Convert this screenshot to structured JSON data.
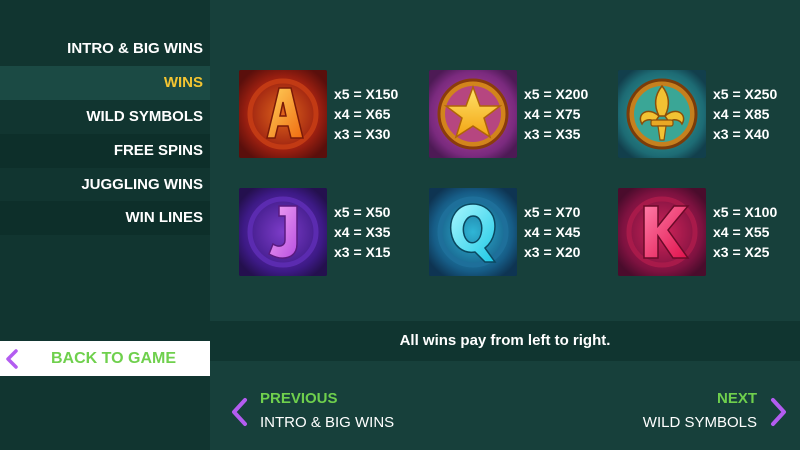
{
  "sidebar": {
    "items": [
      {
        "label": "INTRO & BIG WINS"
      },
      {
        "label": "WINS",
        "active": true
      },
      {
        "label": "WILD SYMBOLS"
      },
      {
        "label": "FREE SPINS"
      },
      {
        "label": "JUGGLING WINS"
      },
      {
        "label": "WIN LINES"
      }
    ],
    "back_label": "BACK TO GAME"
  },
  "symbols": [
    {
      "icon": "letter-a-symbol",
      "payouts": [
        "x5 = X150",
        "x4 = X65",
        "x3 = X30"
      ]
    },
    {
      "icon": "star-symbol",
      "payouts": [
        "x5 = X200",
        "x4 = X75",
        "x3 = X35"
      ]
    },
    {
      "icon": "fleur-de-lis-symbol",
      "payouts": [
        "x5 = X250",
        "x4 = X85",
        "x3 = X40"
      ]
    },
    {
      "icon": "letter-j-symbol",
      "payouts": [
        "x5 = X50",
        "x4 = X35",
        "x3 = X15"
      ]
    },
    {
      "icon": "letter-q-symbol",
      "payouts": [
        "x5 = X70",
        "x4 = X45",
        "x3 = X20"
      ]
    },
    {
      "icon": "letter-k-symbol",
      "payouts": [
        "x5 = X100",
        "x4 = X55",
        "x3 = X25"
      ]
    }
  ],
  "info_text": "All wins pay from left to right.",
  "navigation": {
    "previous_label": "PREVIOUS",
    "previous_page": "INTRO & BIG WINS",
    "next_label": "NEXT",
    "next_page": "WILD SYMBOLS"
  },
  "colors": {
    "background": "#17403b",
    "sidebar": "#113530",
    "active_text": "#f4c531",
    "accent_green": "#6fd04d",
    "accent_purple": "#b35cf0"
  }
}
